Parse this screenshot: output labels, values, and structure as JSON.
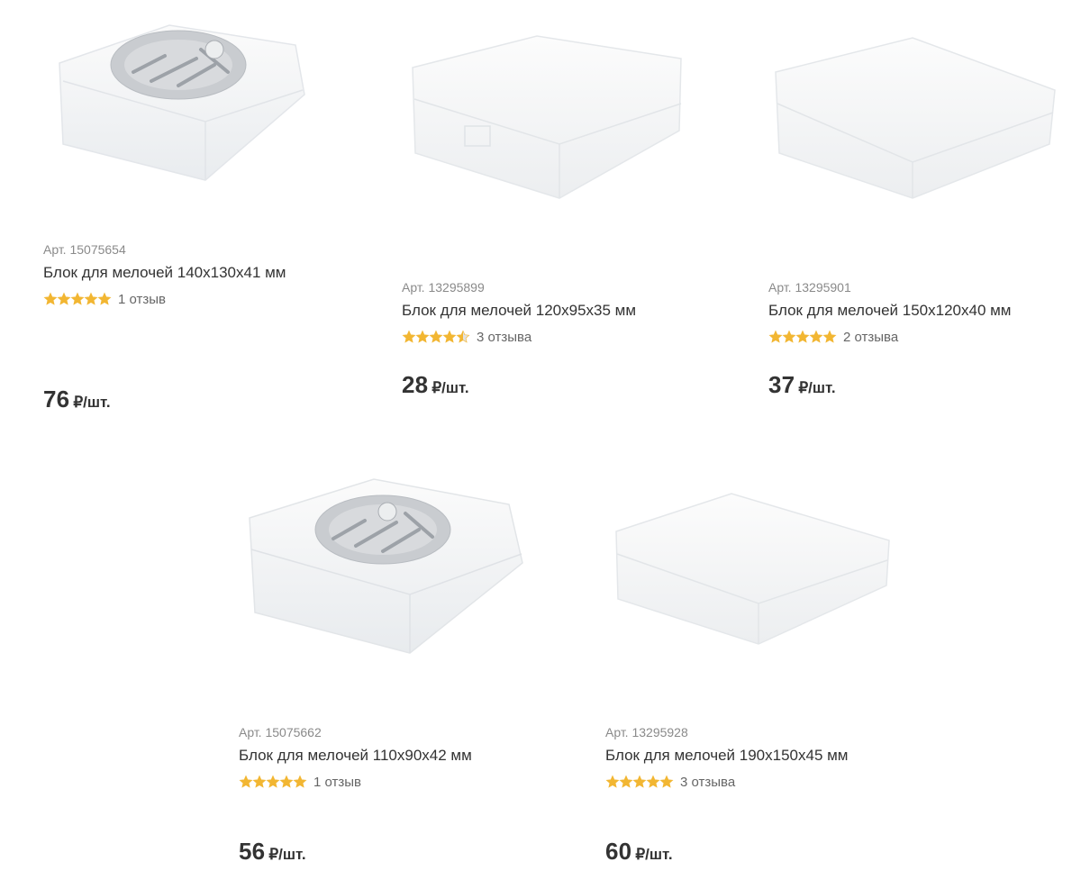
{
  "products": [
    {
      "art": "Арт. 15075654",
      "title": "Блок для мелочей 140x130x41 мм",
      "rating": 5,
      "reviews": "1 отзыв",
      "price": "76",
      "unit": "₽/шт.",
      "image": "box-with-label"
    },
    {
      "art": "Арт. 13295899",
      "title": "Блок для мелочей 120x95x35 мм",
      "rating": 4.5,
      "reviews": "3 отзыва",
      "price": "28",
      "unit": "₽/шт.",
      "image": "plain-box"
    },
    {
      "art": "Арт. 13295901",
      "title": "Блок для мелочей 150x120x40 мм",
      "rating": 5,
      "reviews": "2 отзыва",
      "price": "37",
      "unit": "₽/шт.",
      "image": "plain-box"
    },
    {
      "art": "Арт. 15075662",
      "title": "Блок для мелочей 110x90x42 мм",
      "rating": 5,
      "reviews": "1 отзыв",
      "price": "56",
      "unit": "₽/шт.",
      "image": "box-with-label"
    },
    {
      "art": "Арт. 13295928",
      "title": "Блок для мелочей 190x150x45 мм",
      "rating": 5,
      "reviews": "3 отзыва",
      "price": "60",
      "unit": "₽/шт.",
      "image": "plain-box"
    }
  ],
  "colors": {
    "star": "#f2b632",
    "star_empty": "#e2e2e2",
    "text": "#333333",
    "muted": "#8a8a8a"
  }
}
